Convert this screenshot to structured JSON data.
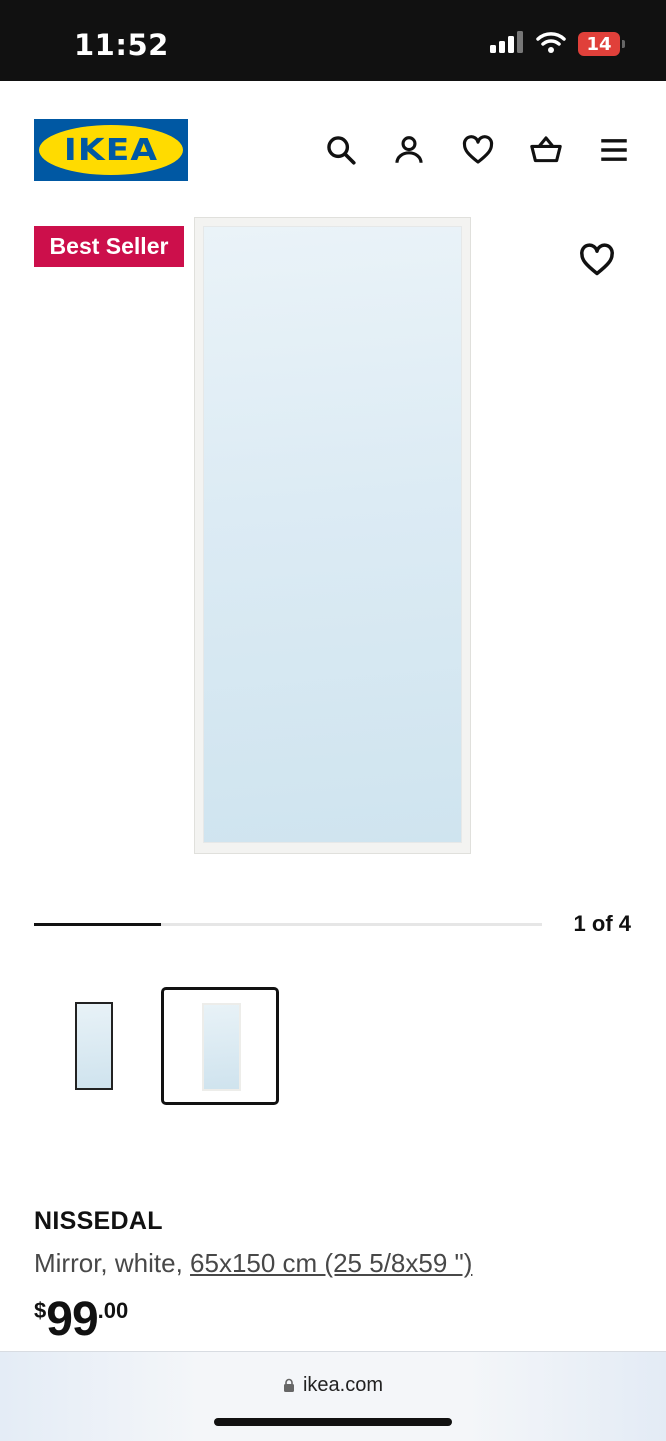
{
  "status_bar": {
    "time": "11:52",
    "battery": "14"
  },
  "header": {
    "logo_text": "IKEA",
    "icons": [
      "search-icon",
      "user-icon",
      "heart-icon",
      "basket-icon",
      "menu-icon"
    ]
  },
  "product": {
    "badge": "Best Seller",
    "gallery": {
      "counter": "1 of 4",
      "progress_fraction": 0.25
    },
    "name": "NISSEDAL",
    "description_prefix": "Mirror, white, ",
    "description_dimensions": "65x150 cm (25 5/8x59 \")",
    "price": {
      "currency": "$",
      "integer": "99",
      "decimal": ".00"
    }
  },
  "browser": {
    "url": "ikea.com"
  },
  "colors": {
    "brand_blue": "#0058a3",
    "brand_yellow": "#ffdb00",
    "badge": "#cc0f4b"
  }
}
